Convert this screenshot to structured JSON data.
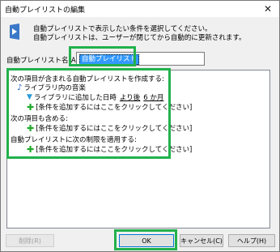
{
  "window": {
    "title": "自動プレイリストの編集",
    "close_glyph": "✕"
  },
  "description": {
    "line1": "自動プレイリストで表示したい条件を選択してください。",
    "line2": "自動プレイリストは、ユーザーが閉じてから自動的に更新されます。"
  },
  "name_field": {
    "label": "自動プレイリスト名(A):",
    "value": "自動プレイリスト"
  },
  "rules": {
    "section1_heading": "次の項目が含まれる自動プレイリストを作成する:",
    "library_music": "ライブラリ内の音楽",
    "condition_text": "ライブラリに追加した日時",
    "condition_operator": "より後",
    "condition_value": "6 か月",
    "add_condition_1": "[条件を追加するにはここをクリックしてください]",
    "section2_heading": "次の項目も含める:",
    "add_condition_2": "[条件を追加するにはここをクリックしてください]",
    "section3_heading": "自動プレイリストに次の制限を適用する:",
    "add_condition_3": "[条件を追加するにはここをクリックしてください]"
  },
  "buttons": {
    "delete": "削除(R)",
    "ok": "OK",
    "cancel": "キャンセル(C)",
    "help": "ヘルプ(H)"
  },
  "colors": {
    "highlight_green": "#22b14c",
    "selection_blue": "#3399ff",
    "plus_green": "#1fa92b"
  },
  "icons": [
    "media-player-icon",
    "music-note-icon",
    "filter-icon",
    "add-plus-icon",
    "close-icon"
  ]
}
